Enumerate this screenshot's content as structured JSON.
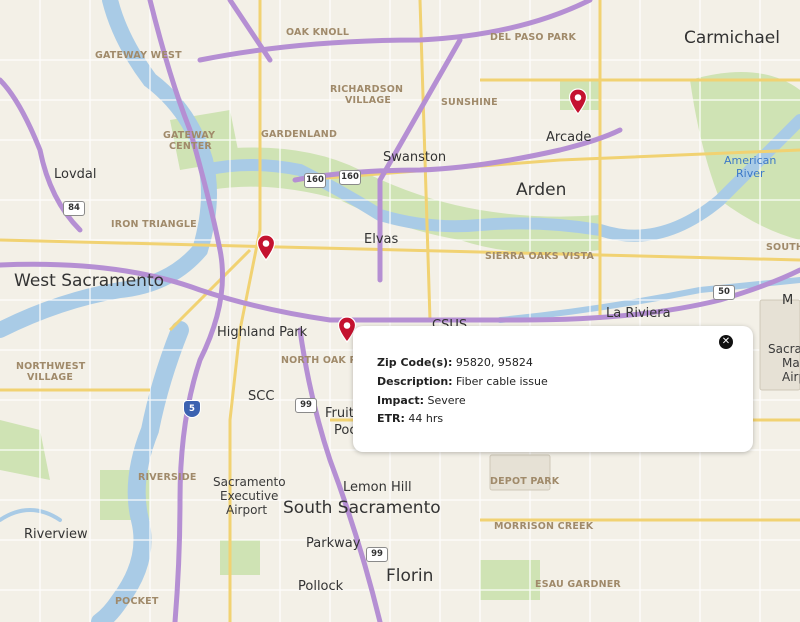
{
  "cities_large": [
    {
      "id": "carmichael",
      "name": "Carmichael"
    },
    {
      "id": "arden",
      "name": "Arden"
    },
    {
      "id": "west-sacramento",
      "name": "West Sacramento"
    },
    {
      "id": "south-sacramento",
      "name": "South Sacramento"
    },
    {
      "id": "florin",
      "name": "Florin"
    }
  ],
  "places": [
    {
      "id": "lovdal",
      "name": "Lovdal"
    },
    {
      "id": "swanston",
      "name": "Swanston"
    },
    {
      "id": "arcade",
      "name": "Arcade"
    },
    {
      "id": "elvas",
      "name": "Elvas"
    },
    {
      "id": "highland-park",
      "name": "Highland Park"
    },
    {
      "id": "csus",
      "name": "CSUS"
    },
    {
      "id": "la-riviera",
      "name": "La Riviera"
    },
    {
      "id": "scc",
      "name": "SCC"
    },
    {
      "id": "fruit",
      "name": "Fruit"
    },
    {
      "id": "poc",
      "name": "Poc"
    },
    {
      "id": "lemon-hill",
      "name": "Lemon Hill"
    },
    {
      "id": "parkway",
      "name": "Parkway"
    },
    {
      "id": "pollock",
      "name": "Pollock"
    },
    {
      "id": "riverview",
      "name": "Riverview"
    },
    {
      "id": "sac-exec-1",
      "name": "Sacramento"
    },
    {
      "id": "sac-exec-2",
      "name": "Executive"
    },
    {
      "id": "sac-exec-3",
      "name": "Airport"
    },
    {
      "id": "m-edge",
      "name": "M"
    },
    {
      "id": "sacr-edge",
      "name": "Sacrar"
    },
    {
      "id": "ma-edge",
      "name": "Ma"
    },
    {
      "id": "airp-edge",
      "name": "Airp"
    }
  ],
  "neighborhoods": [
    {
      "id": "gateway-west",
      "name": "GATEWAY WEST"
    },
    {
      "id": "oak-knoll",
      "name": "OAK KNOLL"
    },
    {
      "id": "del-paso-park",
      "name": "DEL PASO PARK"
    },
    {
      "id": "richardson-1",
      "name": "RICHARDSON"
    },
    {
      "id": "richardson-2",
      "name": "VILLAGE"
    },
    {
      "id": "sunshine",
      "name": "SUNSHINE"
    },
    {
      "id": "gardenland",
      "name": "GARDENLAND"
    },
    {
      "id": "gateway-center-1",
      "name": "GATEWAY"
    },
    {
      "id": "gateway-center-2",
      "name": "CENTER"
    },
    {
      "id": "iron-triangle",
      "name": "IRON TRIANGLE"
    },
    {
      "id": "sierra-oaks-vista",
      "name": "SIERRA OAKS VISTA"
    },
    {
      "id": "north-oak-park",
      "name": "NORTH OAK PA"
    },
    {
      "id": "northwest-village-1",
      "name": "NORTHWEST"
    },
    {
      "id": "northwest-village-2",
      "name": "VILLAGE"
    },
    {
      "id": "riverside",
      "name": "RIVERSIDE"
    },
    {
      "id": "depot-park",
      "name": "DEPOT PARK"
    },
    {
      "id": "morrison-creek",
      "name": "MORRISON CREEK"
    },
    {
      "id": "esau-gardner",
      "name": "ESAU GARDNER"
    },
    {
      "id": "pocket",
      "name": "POCKET"
    },
    {
      "id": "south-edge",
      "name": "SOUTH"
    }
  ],
  "water_labels": [
    {
      "id": "american-river-1",
      "name": "American"
    },
    {
      "id": "american-river-2",
      "name": "River"
    }
  ],
  "shields": [
    {
      "id": "us-84",
      "label": "84"
    },
    {
      "id": "sr-160-a",
      "label": "160"
    },
    {
      "id": "sr-160-b",
      "label": "160"
    },
    {
      "id": "us-50",
      "label": "50"
    },
    {
      "id": "i-5",
      "label": "5"
    },
    {
      "id": "sr-99-a",
      "label": "99"
    },
    {
      "id": "sr-99-b",
      "label": "99"
    }
  ],
  "pins": [
    {
      "id": "pin-downtown",
      "color": "#c4122f"
    },
    {
      "id": "pin-arcade",
      "color": "#c4122f"
    },
    {
      "id": "pin-oak-park",
      "color": "#c4122f"
    }
  ],
  "popup": {
    "zip_label": "Zip Code(s):",
    "zip_value": "95820, 95824",
    "description_label": "Description:",
    "description_value": "Fiber cable issue",
    "impact_label": "Impact:",
    "impact_value": "Severe",
    "etr_label": "ETR:",
    "etr_value": "44 hrs",
    "close_symbol": "✕"
  },
  "colors": {
    "land": "#f3f0e7",
    "water": "#a9cbe6",
    "park": "#c6dfa8",
    "highway": "#b58fd3",
    "major_road": "#f1d272",
    "pin": "#c4122f"
  }
}
